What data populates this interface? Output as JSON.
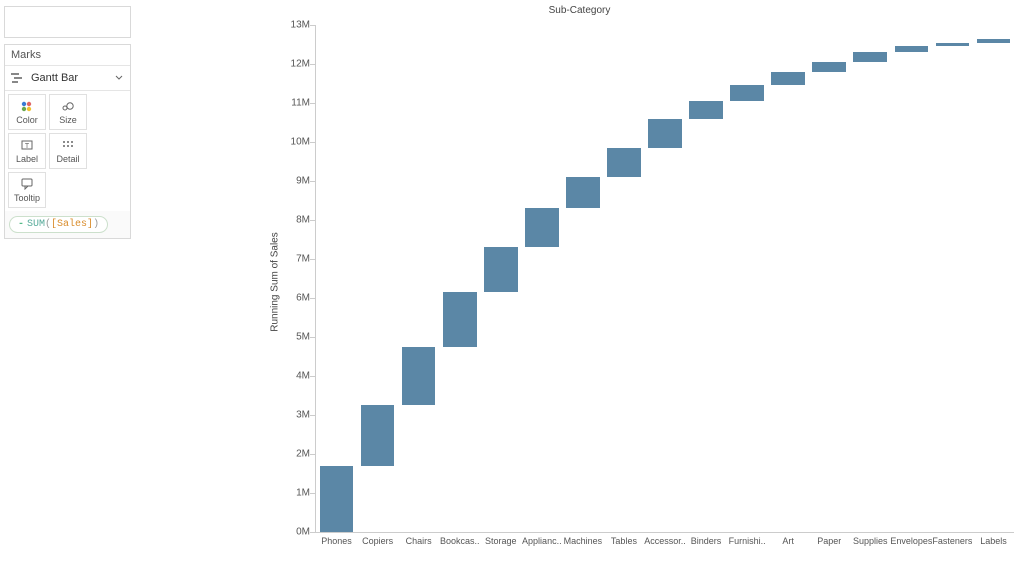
{
  "sidebar": {
    "marks_title": "Marks",
    "mark_type": "Gantt Bar",
    "cells": [
      {
        "id": "color",
        "label": "Color"
      },
      {
        "id": "size",
        "label": "Size"
      },
      {
        "id": "label",
        "label": "Label"
      },
      {
        "id": "detail",
        "label": "Detail"
      },
      {
        "id": "tooltip",
        "label": "Tooltip"
      }
    ],
    "pill": {
      "minus": "-",
      "fn": "SUM",
      "open": "(",
      "field": "[Sales]",
      "close": ")"
    }
  },
  "chart_data": {
    "type": "bar",
    "title": "Sub-Category",
    "ylabel": "Running Sum of Sales",
    "xlabel": "",
    "ylim": [
      0,
      13000000
    ],
    "y_ticks": [
      {
        "v": 0,
        "label": "0M"
      },
      {
        "v": 1000000,
        "label": "1M"
      },
      {
        "v": 2000000,
        "label": "2M"
      },
      {
        "v": 3000000,
        "label": "3M"
      },
      {
        "v": 4000000,
        "label": "4M"
      },
      {
        "v": 5000000,
        "label": "5M"
      },
      {
        "v": 6000000,
        "label": "6M"
      },
      {
        "v": 7000000,
        "label": "7M"
      },
      {
        "v": 8000000,
        "label": "8M"
      },
      {
        "v": 9000000,
        "label": "9M"
      },
      {
        "v": 10000000,
        "label": "10M"
      },
      {
        "v": 11000000,
        "label": "11M"
      },
      {
        "v": 12000000,
        "label": "12M"
      },
      {
        "v": 13000000,
        "label": "13M"
      }
    ],
    "categories": [
      "Phones",
      "Copiers",
      "Chairs",
      "Bookcas..",
      "Storage",
      "Applianc..",
      "Machines",
      "Tables",
      "Accessor..",
      "Binders",
      "Furnishi..",
      "Art",
      "Paper",
      "Supplies",
      "Envelopes",
      "Fasteners",
      "Labels"
    ],
    "bars": [
      {
        "category": "Phones",
        "start": 0,
        "end": 1700000
      },
      {
        "category": "Copiers",
        "start": 1700000,
        "end": 3250000
      },
      {
        "category": "Chairs",
        "start": 3250000,
        "end": 4750000
      },
      {
        "category": "Bookcas..",
        "start": 4750000,
        "end": 6150000
      },
      {
        "category": "Storage",
        "start": 6150000,
        "end": 7300000
      },
      {
        "category": "Applianc..",
        "start": 7300000,
        "end": 8300000
      },
      {
        "category": "Machines",
        "start": 8300000,
        "end": 9100000
      },
      {
        "category": "Tables",
        "start": 9100000,
        "end": 9850000
      },
      {
        "category": "Accessor..",
        "start": 9850000,
        "end": 10600000
      },
      {
        "category": "Binders",
        "start": 10600000,
        "end": 11050000
      },
      {
        "category": "Furnishi..",
        "start": 11050000,
        "end": 11450000
      },
      {
        "category": "Art",
        "start": 11450000,
        "end": 11800000
      },
      {
        "category": "Paper",
        "start": 11800000,
        "end": 12050000
      },
      {
        "category": "Supplies",
        "start": 12050000,
        "end": 12300000
      },
      {
        "category": "Envelopes",
        "start": 12300000,
        "end": 12450000
      },
      {
        "category": "Fasteners",
        "start": 12450000,
        "end": 12550000
      },
      {
        "category": "Labels",
        "start": 12550000,
        "end": 12630000
      }
    ]
  }
}
